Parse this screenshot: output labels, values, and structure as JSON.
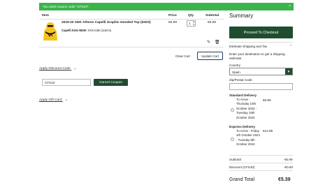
{
  "message": {
    "text": "You used coupon code \"CFS10\".",
    "close": "×"
  },
  "cart": {
    "headers": {
      "item": "Item",
      "price": "Price",
      "qty": "Qty",
      "subtotal": "Subtotal"
    },
    "product": {
      "name": "2019-20 AEK Athens Capelli Graphic Hooded Top (KIDS)",
      "attr_label": "Capelli Kids NEW:",
      "attr_value": "XXS.Kids (116cm)",
      "price": "€5.99",
      "qty": "1",
      "subtotal": "€5.99"
    },
    "clear_label": "Clear Cart",
    "update_label": "Update Cart"
  },
  "discount": {
    "toggle": "Apply Discount Code",
    "code": "CFS10",
    "cancel_label": "Cancel Coupon"
  },
  "giftcard": {
    "toggle": "Apply Gift Card"
  },
  "summary": {
    "title": "Summary",
    "checkout_label": "Proceed To Checkout",
    "estimate_title": "Estimate Shipping and Tax",
    "estimate_note": [
      "Enter your destination to get a shipping",
      "estimate."
    ],
    "country_label": "Country",
    "country_value": "Spain",
    "postcode_label": "Zip/Postal Code",
    "standard_title": "Standard Delivery",
    "standard_lines": [
      "To Arrive :",
      "Thursday 10th",
      "October 2024 -",
      "Tuesday 15th",
      "October 2024"
    ],
    "standard_price": "€6.99",
    "express_title": "Express Delivery",
    "express_lines": [
      "To Arrive : Friday",
      "4th October 2024",
      "- Tuesday 8th",
      "October 2024"
    ],
    "express_price": "€14.99",
    "subtotal_label": "Subtotal",
    "subtotal_value": "€5.99",
    "discount_label": "Discount (CFS10)",
    "discount_value": "-€0.60",
    "grand_label": "Grand Total",
    "grand_value": "€5.39"
  },
  "icons": {
    "edit": "pencil-icon",
    "delete": "trash-icon",
    "chevron": "chevron-down-icon"
  },
  "colors": {
    "message_bg": "#39b54a",
    "button_green": "#1f4d2e"
  }
}
